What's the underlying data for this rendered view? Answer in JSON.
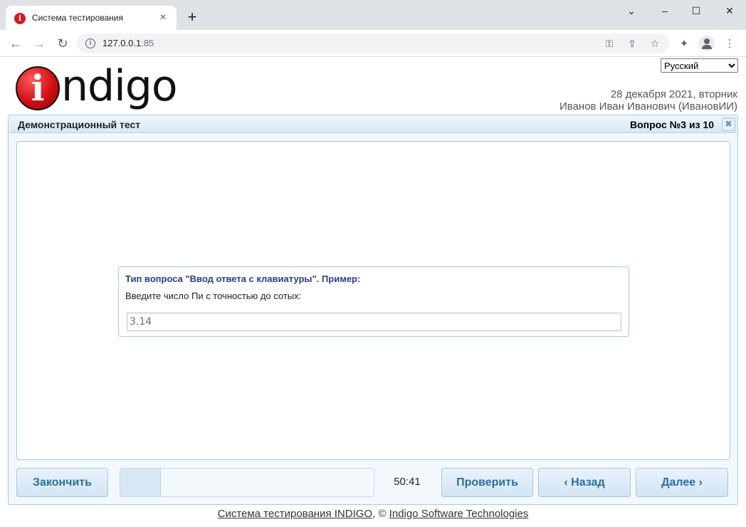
{
  "browser": {
    "tab_title": "Система тестирования",
    "new_tab_label": "+",
    "url_host": "127.0.0.1",
    "url_port": ":85"
  },
  "header": {
    "logo_text": "ndigo",
    "logo_letter": "i",
    "language_selected": "Русский",
    "language_options": [
      "Русский"
    ],
    "date": "28 декабря 2021, вторник",
    "user": "Иванов Иван Иванович (ИвановИИ)"
  },
  "panel": {
    "title": "Демонстрационный тест",
    "counter": "Вопрос №3 из 10",
    "close_label": "✖"
  },
  "question": {
    "heading": "Тип вопроса \"Ввод ответа с клавиатуры\". Пример:",
    "text": "Введите число Пи с точностью до сотых:",
    "answer_value": "3.14"
  },
  "controls": {
    "finish_label": "Закончить",
    "check_label": "Проверить",
    "back_label": "‹ Назад",
    "next_label": "Далее ›",
    "timer": "50:41",
    "progress_fraction": 0.16
  },
  "footer": {
    "system_link": "Система тестирования INDIGO",
    "separator": ", © ",
    "company_link": "Indigo Software Technologies"
  },
  "colors": {
    "accent": "#2e6e9e",
    "panel_border": "#a6c9e2",
    "heading_color": "#2e3a8c",
    "logo_red": "#d10f14"
  }
}
